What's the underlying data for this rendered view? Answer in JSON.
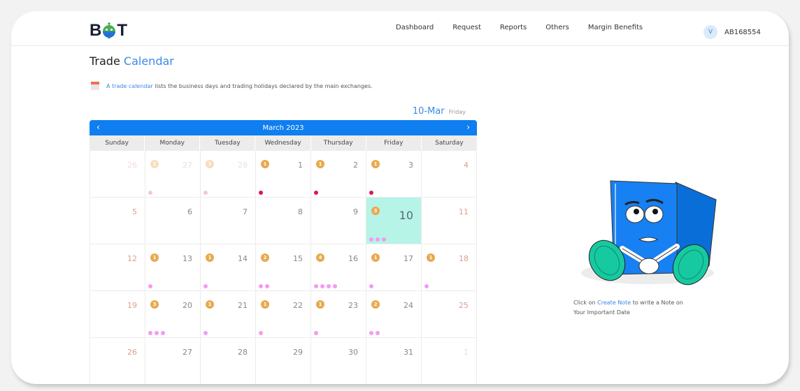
{
  "brand": {
    "left": "B",
    "right": "T"
  },
  "nav": {
    "items": [
      "Dashboard",
      "Request",
      "Reports",
      "Others",
      "Margin Benefits"
    ]
  },
  "user": {
    "avatar_initial": "V",
    "id": "AB168554"
  },
  "page": {
    "title_plain": "Trade",
    "title_accent": "Calendar"
  },
  "info": {
    "link": "A trade calendar",
    "text": "lists the business days and trading holidays declared by the main exchanges."
  },
  "selected": {
    "date": "10-Mar",
    "weekday": "Friday"
  },
  "calendar": {
    "month_label": "March 2023",
    "prev_icon": "‹",
    "next_icon": "›",
    "weekdays": [
      "Sunday",
      "Monday",
      "Tuesday",
      "Wednesday",
      "Thursday",
      "Friday",
      "Saturday"
    ],
    "weeks": [
      [
        {
          "day": "26",
          "other": true,
          "badge": null,
          "dots": 0
        },
        {
          "day": "27",
          "other": true,
          "badge": "1",
          "dots": 1
        },
        {
          "day": "28",
          "other": true,
          "badge": "1",
          "dots": 1
        },
        {
          "day": "1",
          "badge": "1",
          "dots": 1,
          "dot_color": "red"
        },
        {
          "day": "2",
          "badge": "1",
          "dots": 1,
          "dot_color": "red"
        },
        {
          "day": "3",
          "badge": "1",
          "dots": 1,
          "dot_color": "red"
        },
        {
          "day": "4",
          "badge": null,
          "dots": 0
        }
      ],
      [
        {
          "day": "5",
          "badge": null,
          "dots": 0
        },
        {
          "day": "6",
          "badge": null,
          "dots": 0
        },
        {
          "day": "7",
          "badge": null,
          "dots": 0
        },
        {
          "day": "8",
          "badge": null,
          "dots": 0
        },
        {
          "day": "9",
          "badge": null,
          "dots": 0
        },
        {
          "day": "10",
          "badge": "3",
          "dots": 3,
          "today": true
        },
        {
          "day": "11",
          "badge": null,
          "dots": 0
        }
      ],
      [
        {
          "day": "12",
          "badge": null,
          "dots": 0
        },
        {
          "day": "13",
          "badge": "1",
          "dots": 1
        },
        {
          "day": "14",
          "badge": "1",
          "dots": 1
        },
        {
          "day": "15",
          "badge": "2",
          "dots": 2
        },
        {
          "day": "16",
          "badge": "4",
          "dots": 4
        },
        {
          "day": "17",
          "badge": "1",
          "dots": 1
        },
        {
          "day": "18",
          "badge": "1",
          "dots": 1
        }
      ],
      [
        {
          "day": "19",
          "badge": null,
          "dots": 0
        },
        {
          "day": "20",
          "badge": "3",
          "dots": 3
        },
        {
          "day": "21",
          "badge": "1",
          "dots": 1
        },
        {
          "day": "22",
          "badge": "1",
          "dots": 1
        },
        {
          "day": "23",
          "badge": "1",
          "dots": 1
        },
        {
          "day": "24",
          "badge": "2",
          "dots": 2
        },
        {
          "day": "25",
          "badge": null,
          "dots": 0
        }
      ],
      [
        {
          "day": "26",
          "badge": null,
          "dots": 0
        },
        {
          "day": "27",
          "badge": null,
          "dots": 0
        },
        {
          "day": "28",
          "badge": null,
          "dots": 0
        },
        {
          "day": "29",
          "badge": null,
          "dots": 0
        },
        {
          "day": "30",
          "badge": null,
          "dots": 0
        },
        {
          "day": "31",
          "badge": null,
          "dots": 0
        },
        {
          "day": "1",
          "other": true,
          "badge": null,
          "dots": 0
        }
      ]
    ]
  },
  "note": {
    "prefix": "Click on",
    "link": "Create Note",
    "suffix": "to write a Note on",
    "line2": "Your Important Date"
  },
  "colors": {
    "accent": "#0f7ef0",
    "link": "#3b8ae6",
    "today_bg": "#b6f4e8",
    "badge": "#e8a94e",
    "dot": "#f59af0",
    "dot_red": "#e0145c"
  }
}
